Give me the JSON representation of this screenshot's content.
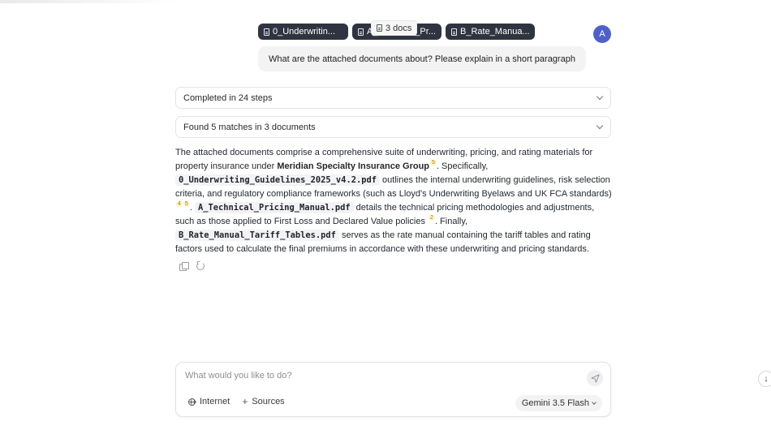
{
  "attachments": {
    "chips": [
      {
        "label": "0_Underwritin..."
      },
      {
        "label": "A_Technical_Pr..."
      },
      {
        "label": "B_Rate_Manua..."
      }
    ],
    "tooltip": "3 docs"
  },
  "user": {
    "avatar_initial": "A",
    "message": "What are the attached documents about? Please explain in a short paragraph"
  },
  "steps_panel": {
    "label": "Completed in 24 steps"
  },
  "matches_panel": {
    "label": "Found 5 matches in 3 documents"
  },
  "answer": {
    "p1": "The attached documents comprise a comprehensive suite of underwriting, pricing, and rating materials for property insurance under ",
    "company": "Meridian Specialty Insurance Group",
    "cite1": "5",
    "p2": ". Specifically, ",
    "doc1": "0_Underwriting_Guidelines_2025_v4.2.pdf",
    "p3": " outlines the internal underwriting guidelines, risk selection criteria, and regulatory compliance frameworks (such as Lloyd's Underwriting Byelaws and UK FCA standards) ",
    "cite2a": "4",
    "cite2b": "5",
    "p4": ". ",
    "doc2": "A_Technical_Pricing_Manual.pdf",
    "p5": " details the technical pricing methodologies and adjustments, such as those applied to First Loss and Declared Value policies ",
    "cite3": "2",
    "p6": ". Finally, ",
    "doc3": "B_Rate_Manual_Tariff_Tables.pdf",
    "p7": " serves as the rate manual containing the tariff tables and rating factors used to calculate the final premiums in accordance with these underwriting and pricing standards."
  },
  "composer": {
    "placeholder": "What would you like to do?",
    "tools": {
      "internet": "Internet",
      "sources": "Sources"
    },
    "model": "Gemini 3.5 Flash"
  },
  "icons": {
    "copy": "copy-icon",
    "retry": "retry-icon",
    "send": "send-icon",
    "globe": "globe-icon",
    "scroll": "arrow-down-icon"
  }
}
